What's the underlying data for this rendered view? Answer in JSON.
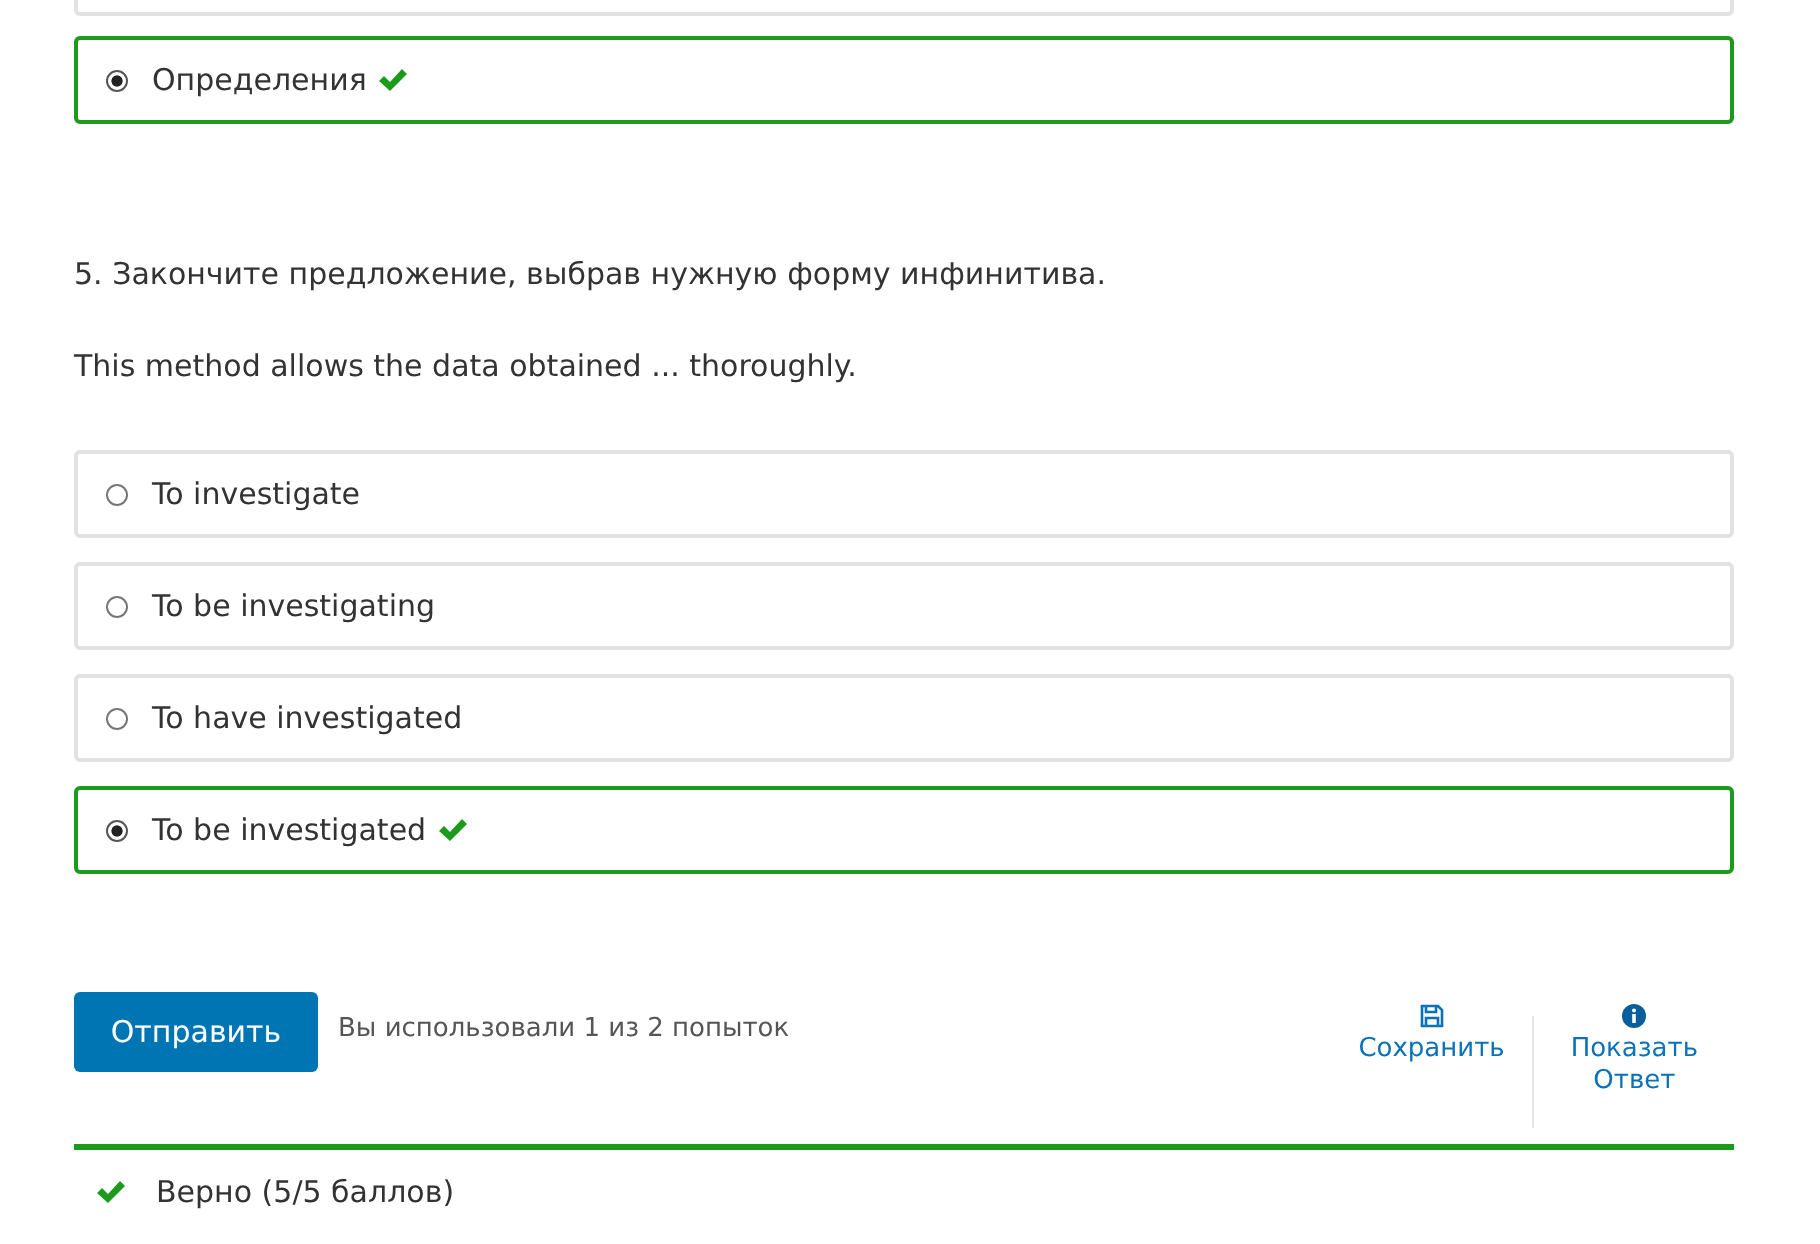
{
  "previous_question": {
    "options": [
      {
        "label": "Определения",
        "selected": true,
        "correct": true
      }
    ]
  },
  "question": {
    "prompt": "5. Закончите предложение, выбрав нужную форму инфинитива.",
    "sentence": "This method allows the data obtained ... thoroughly.",
    "options": [
      {
        "label": "To investigate",
        "selected": false
      },
      {
        "label": "To be investigating",
        "selected": false
      },
      {
        "label": "To have investigated",
        "selected": false
      },
      {
        "label": "To be investigated",
        "selected": true,
        "correct": true
      }
    ]
  },
  "actions": {
    "submit": "Отправить",
    "attempts": "Вы использовали 1 из 2 попыток",
    "save": "Сохранить",
    "show_answer": [
      "Показать",
      "Ответ"
    ]
  },
  "feedback": {
    "correct": true,
    "text": "Верно (5/5 баллов)"
  }
}
